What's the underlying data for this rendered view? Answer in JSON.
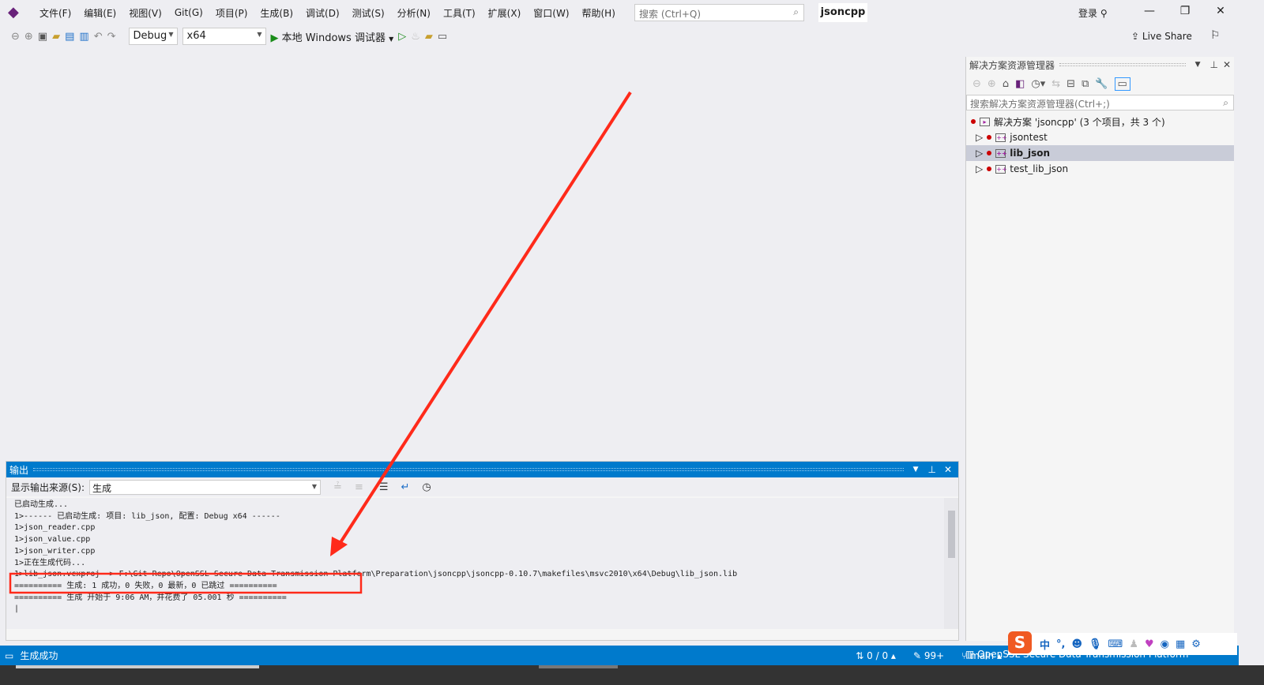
{
  "menubar": {
    "items": [
      "文件(F)",
      "编辑(E)",
      "视图(V)",
      "Git(G)",
      "项目(P)",
      "生成(B)",
      "调试(D)",
      "测试(S)",
      "分析(N)",
      "工具(T)",
      "扩展(X)",
      "窗口(W)",
      "帮助(H)"
    ],
    "search_placeholder": "搜索 (Ctrl+Q)",
    "solution_name": "jsoncpp",
    "login": "登录"
  },
  "toolbar": {
    "config": "Debug",
    "platform": "x64",
    "run_label": "本地 Windows 调试器",
    "live_share": "Live Share"
  },
  "output": {
    "title": "输出",
    "source_label": "显示输出来源(S):",
    "source_value": "生成",
    "lines": [
      "已启动生成...",
      "1>------ 已启动生成: 项目: lib_json, 配置: Debug x64 ------",
      "1>json_reader.cpp",
      "1>json_value.cpp",
      "1>json_writer.cpp",
      "1>正在生成代码...",
      "1>lib_json.vcxproj -> F:\\Git Repo\\OpenSSL Secure Data Transmission Platform\\Preparation\\jsoncpp\\jsoncpp-0.10.7\\makefiles\\msvc2010\\x64\\Debug\\lib_json.lib",
      "========== 生成: 1 成功，0 失败，0 最新，0 已跳过 ==========",
      "========== 生成 开始于 9:06 AM，并花费了 05.001 秒 =========="
    ]
  },
  "solution_explorer": {
    "title": "解决方案资源管理器",
    "search_placeholder": "搜索解决方案资源管理器(Ctrl+;)",
    "root": "解决方案 'jsoncpp' (3 个项目，共 3 个)",
    "projects": [
      "jsontest",
      "lib_json",
      "test_lib_json"
    ],
    "selected": "lib_json"
  },
  "status": {
    "message": "生成成功",
    "changes": "0 / 0",
    "edits": "99+",
    "branch": "main",
    "repo": "OpenSSL Secure Data Transmission Platform"
  },
  "ime": {
    "lang": "中"
  },
  "colors": {
    "accent": "#007acc",
    "annotation": "#ff2a1a"
  }
}
